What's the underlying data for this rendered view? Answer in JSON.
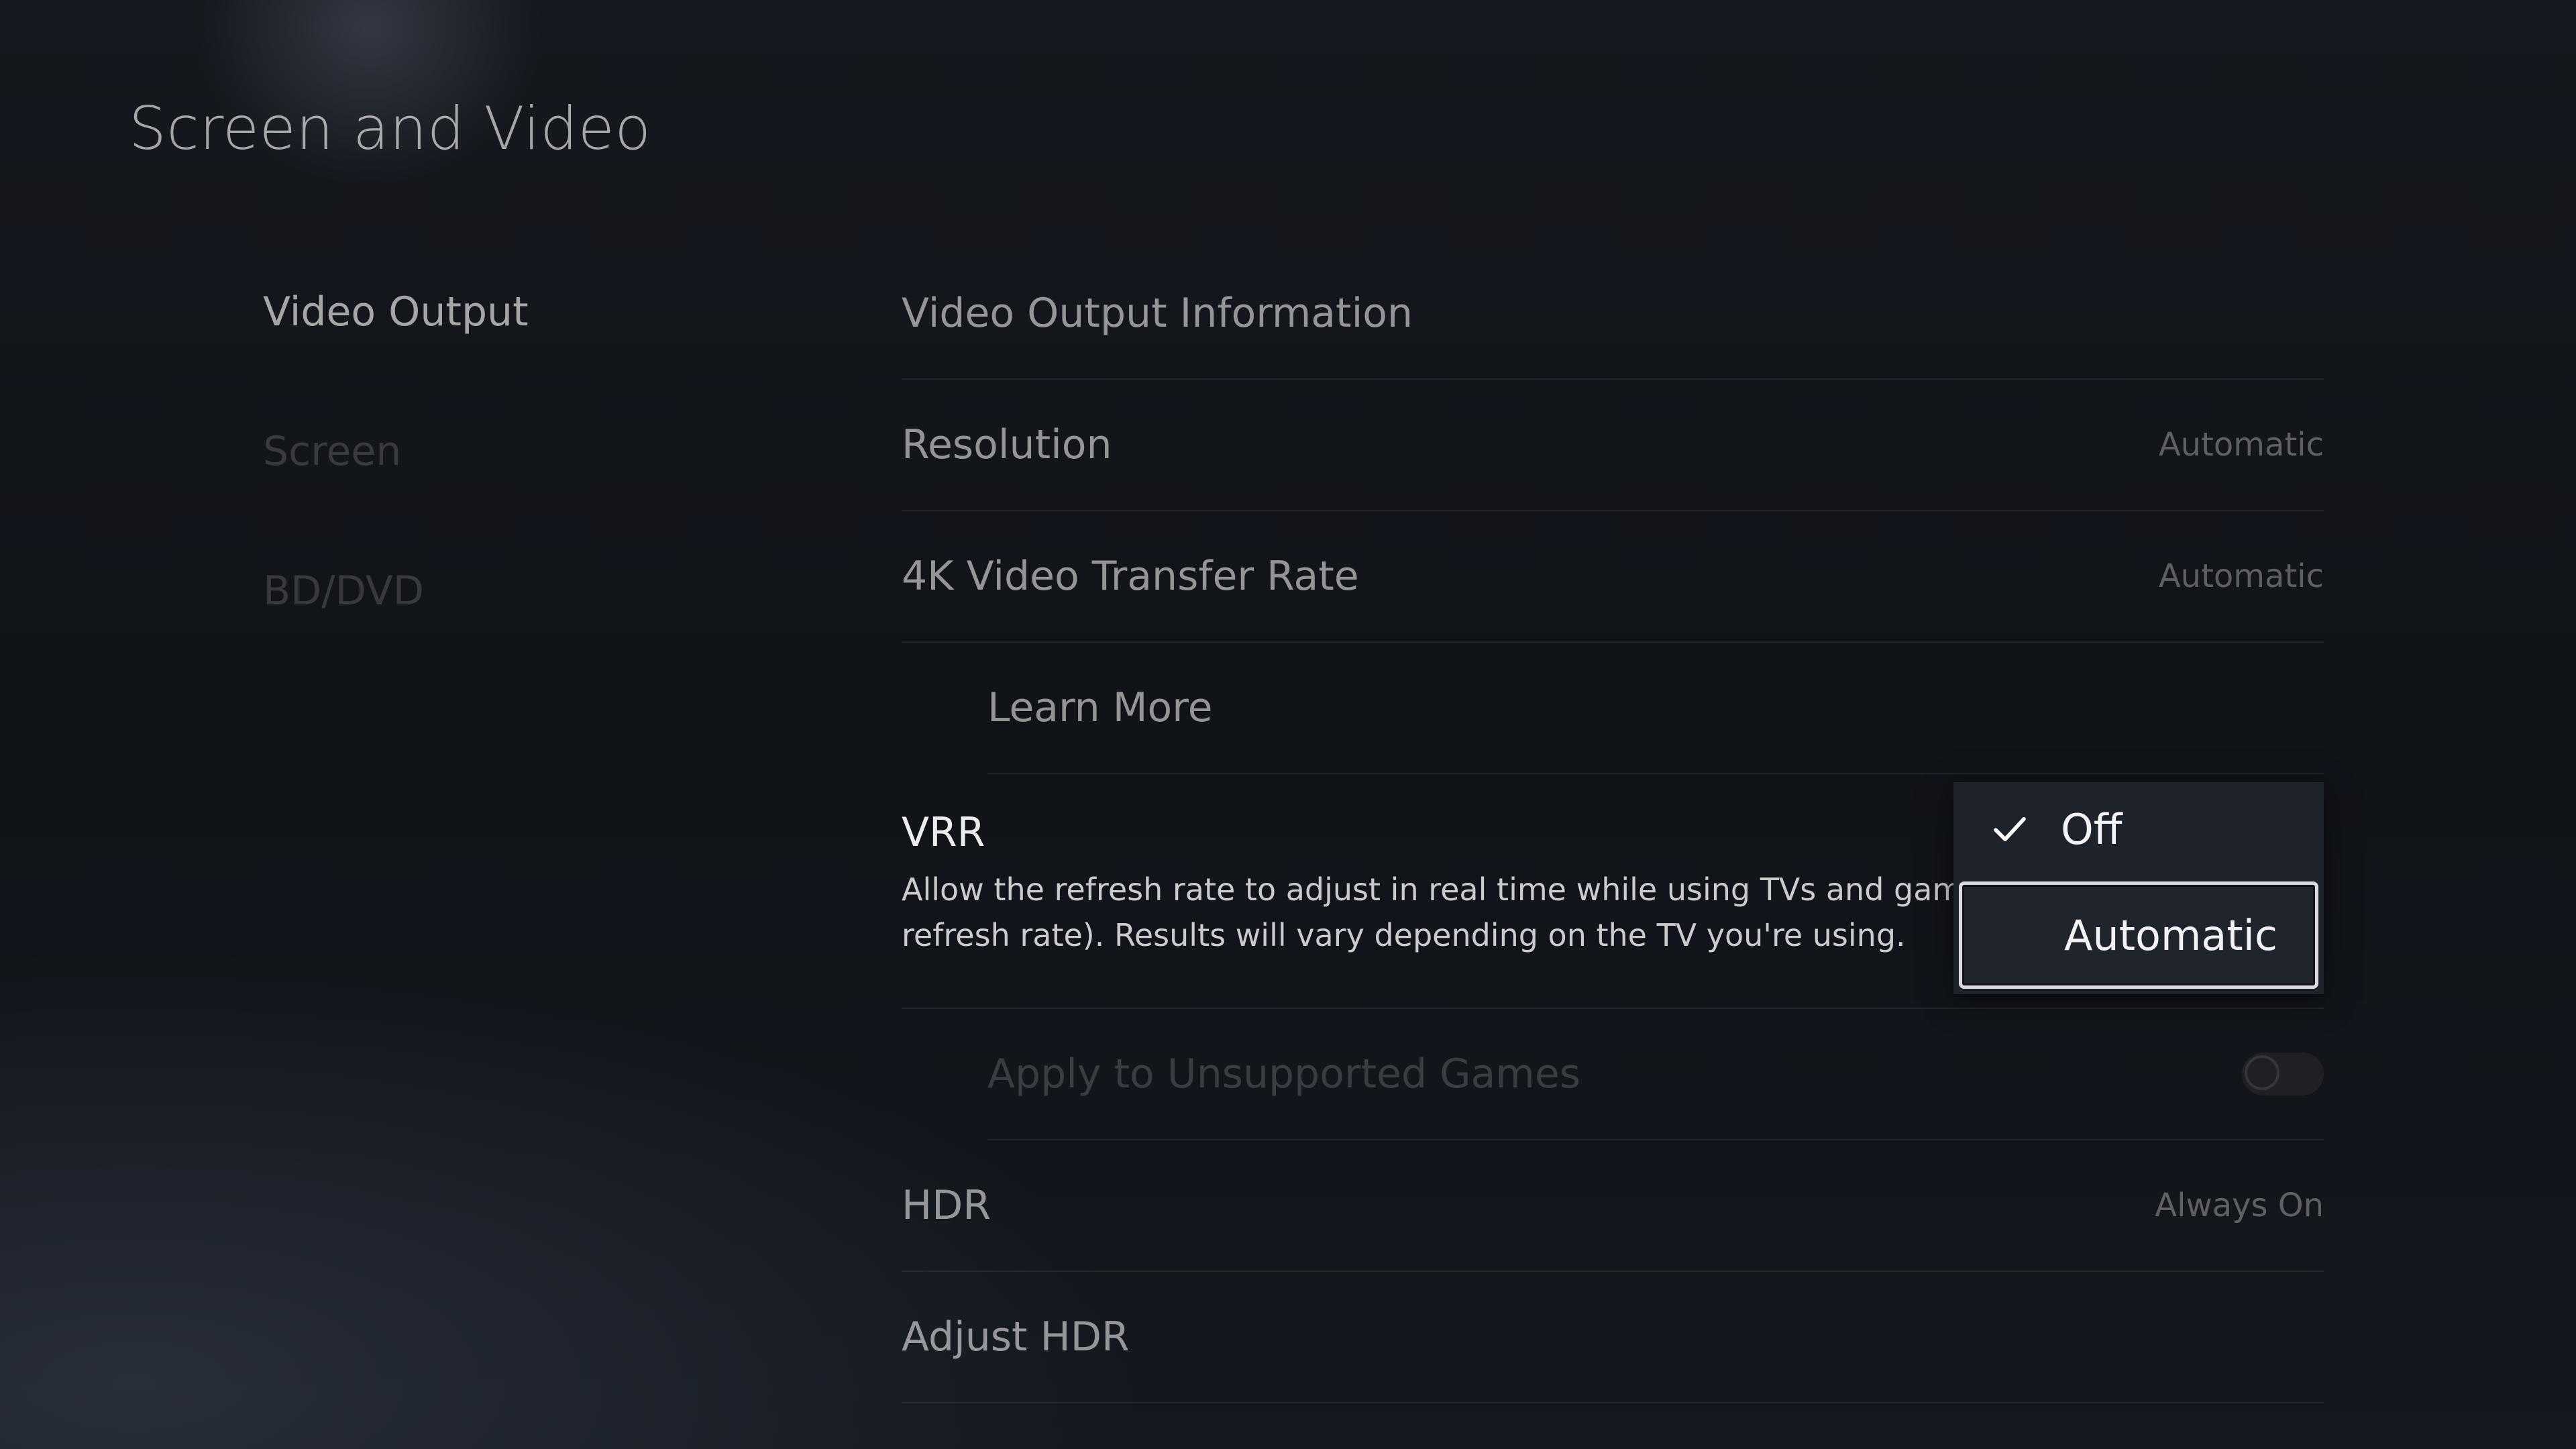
{
  "header": {
    "title": "Screen and Video"
  },
  "sidebar": {
    "items": [
      {
        "label": "Video Output"
      },
      {
        "label": "Screen"
      },
      {
        "label": "BD/DVD"
      }
    ]
  },
  "settings": {
    "video_output_information": {
      "label": "Video Output Information"
    },
    "resolution": {
      "label": "Resolution",
      "value": "Automatic"
    },
    "transfer_rate": {
      "label": "4K Video Transfer Rate",
      "value": "Automatic"
    },
    "learn_more": {
      "label": "Learn More"
    },
    "vrr": {
      "label": "VRR",
      "description": "Allow the refresh rate to adjust in real time while using TVs and games that support VRR (variable\nrefresh rate). Results will vary depending on the TV you're using."
    },
    "apply_unsupported": {
      "label": "Apply to Unsupported Games",
      "toggle_on": false
    },
    "hdr": {
      "label": "HDR",
      "value": "Always On"
    },
    "adjust_hdr": {
      "label": "Adjust HDR"
    }
  },
  "dropdown": {
    "options": [
      {
        "label": "Off",
        "checked": true
      },
      {
        "label": "Automatic",
        "focused": true
      }
    ]
  }
}
